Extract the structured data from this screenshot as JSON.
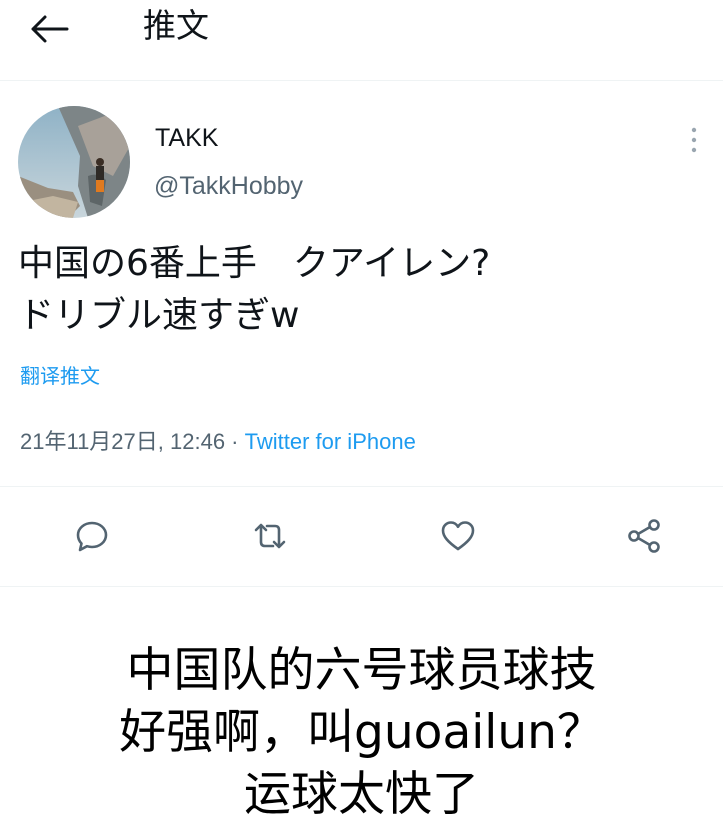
{
  "header": {
    "title": "推文"
  },
  "tweet": {
    "author": {
      "display_name": "TAKK",
      "handle": "@TakkHobby"
    },
    "text_lines": [
      "中国の6番上手　クアイレン?",
      "ドリブル速すぎw"
    ],
    "translate_label": "翻译推文",
    "timestamp": "21年11月27日, 12:46",
    "separator": " · ",
    "source": "Twitter for iPhone"
  },
  "actions": [
    "reply-icon",
    "retweet-icon",
    "like-icon",
    "share-icon"
  ],
  "caption": {
    "lines": [
      "中国队的六号球员球技",
      "好强啊，叫guoailun？",
      "运球太快了"
    ]
  },
  "colors": {
    "accent": "#1d9bf0",
    "secondary_text": "#536471",
    "divider": "#eff3f4"
  }
}
